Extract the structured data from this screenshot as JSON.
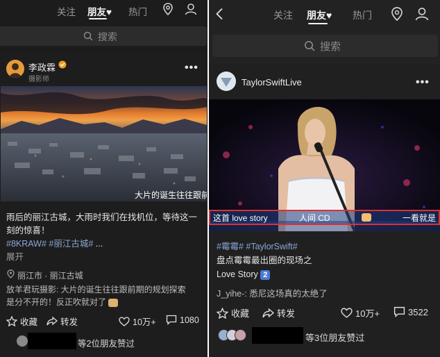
{
  "left": {
    "nav": {
      "follow": "关注",
      "friends": "朋友",
      "hot": "热门"
    },
    "search_placeholder": "搜索",
    "post": {
      "username": "李政霖",
      "role": "摄影师",
      "image_caption": "大片的诞生往往跟前",
      "text_line1": "雨后的丽江古城，大雨时我们在找机位，等待这一",
      "text_line2": "刻的惊喜！",
      "tag1": "#8KRAW#",
      "tag2": "#丽江古城#",
      "ellipsis": "...",
      "expand": "展开",
      "location": "丽江市 · 丽江古城",
      "comment_user": "放羊君玩摄影:",
      "comment_line1": " 大片的诞生往往跟前期的规划探索",
      "comment_line2": "是分不开的！反正吹就对了",
      "collect": "收藏",
      "share": "转发",
      "like_count": "10万+",
      "comment_count": "1080",
      "friends_liked": "等2位朋友赞过"
    }
  },
  "right": {
    "nav": {
      "follow": "关注",
      "friends": "朋友",
      "hot": "热门"
    },
    "search_placeholder": "搜索",
    "post": {
      "username": "TaylorSwiftLive",
      "subtitle_left": "这首 love story",
      "subtitle_mid": "人间 CD",
      "subtitle_right": "一看就是",
      "tag1": "#霉霉#",
      "tag2": "#TaylorSwift#",
      "text_line1": "盘点霉霉最出圈的现场之",
      "text_line2": "Love Story",
      "keycap": "2",
      "comment_user": "J_yihe-:",
      "comment_text": " 悉尼这场真的太绝了",
      "collect": "收藏",
      "share": "转发",
      "like_count": "10万+",
      "comment_count": "3522",
      "friends_liked": "等3位朋友赞过"
    }
  },
  "colors": {
    "tag": "#8aa8d8",
    "highlight_border": "#e03030",
    "verified": "#f0a020"
  }
}
